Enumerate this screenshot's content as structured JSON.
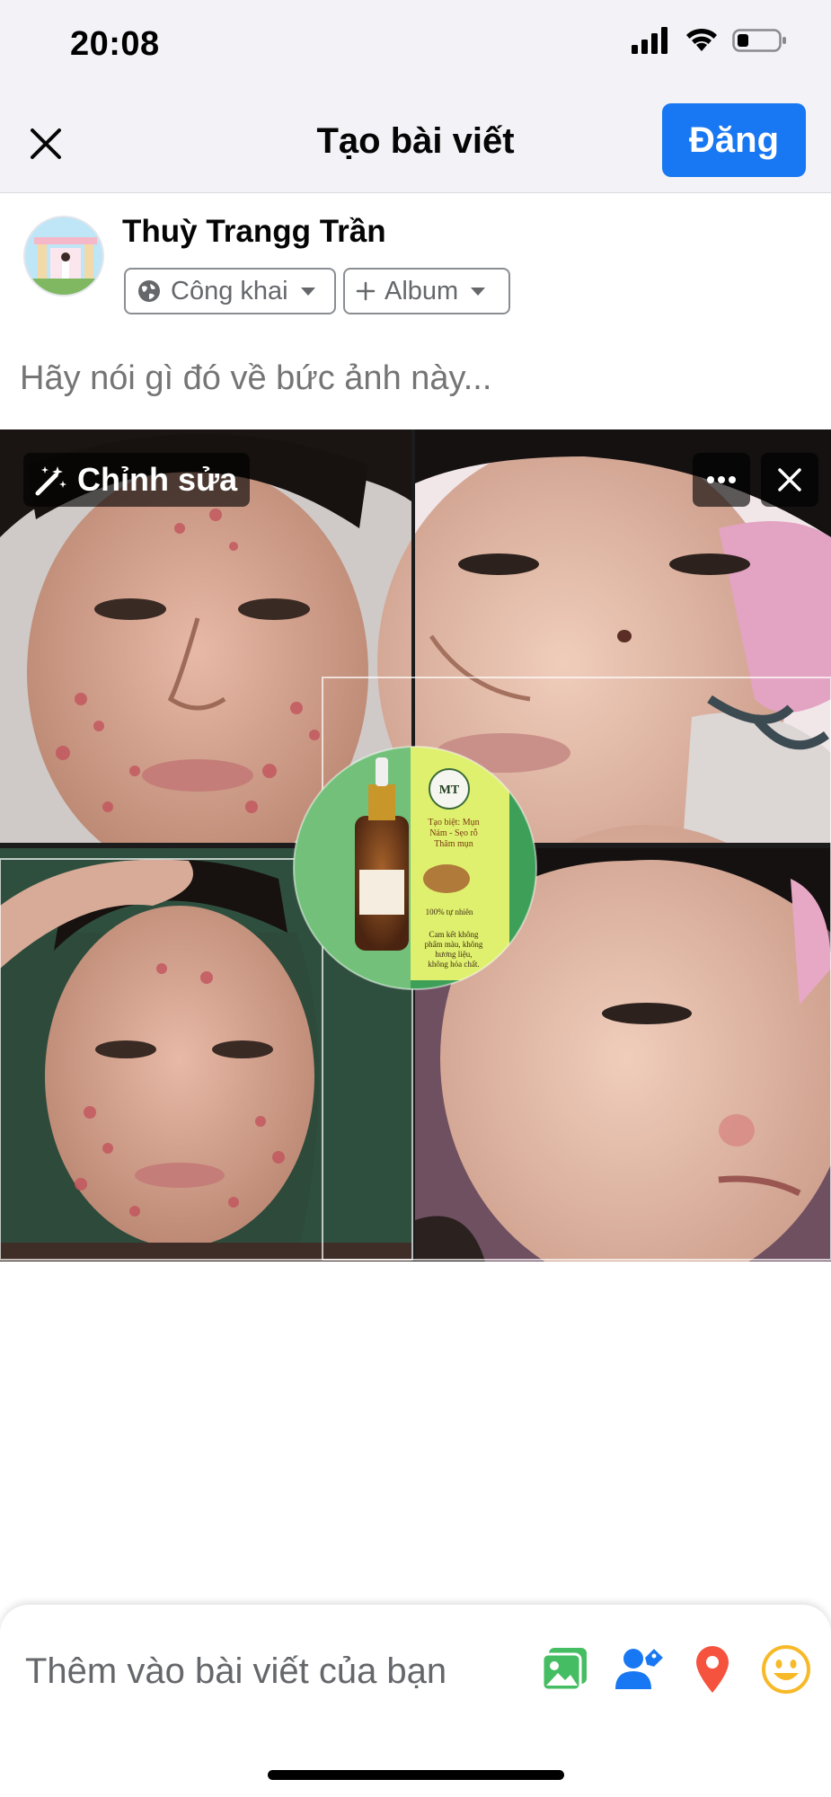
{
  "status_bar": {
    "time": "20:08"
  },
  "header": {
    "title": "Tạo bài viết",
    "post_label": "Đăng"
  },
  "composer": {
    "user_name": "Thuỳ Trangg Trần",
    "privacy_label": "Công khai",
    "album_label": "Album",
    "caption_placeholder": "Hãy nói gì đó về bức ảnh này..."
  },
  "photo": {
    "edit_label": "Chỉnh sửa",
    "product_label": {
      "logo": "MT",
      "line1": "Tạo biệt: Mụn",
      "line2": "Nám - Sẹo rỗ",
      "line3": "Thâm mụn",
      "line4": "100% tự nhiên",
      "line5": "Cam kết không",
      "line6": "phẩm màu, không",
      "line7": "hương liệu,",
      "line8": "không hóa chất."
    }
  },
  "add_to_post": {
    "label": "Thêm vào bài viết của bạn",
    "icons": [
      "photo-icon",
      "tag-people-icon",
      "location-icon",
      "feeling-icon"
    ]
  },
  "colors": {
    "accent": "#1877f2",
    "nav_bg": "#f2f2f7",
    "photo_icon": "#45bd62",
    "location_icon": "#f5533d",
    "feeling_icon": "#f7b928"
  }
}
